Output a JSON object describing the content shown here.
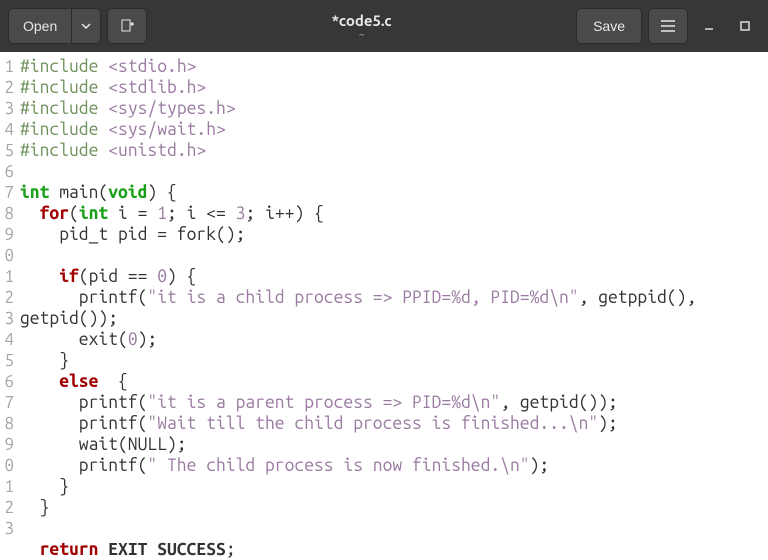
{
  "header": {
    "open_label": "Open",
    "save_label": "Save",
    "title": "*code5.c",
    "subtitle": "~"
  },
  "gutter": [
    "1",
    "2",
    "3",
    "4",
    "5",
    "6",
    "7",
    "8",
    "9",
    "0",
    "1",
    "2",
    "3",
    "4",
    "5",
    "6",
    "7",
    "8",
    "9",
    "0",
    "1",
    "2",
    "3"
  ],
  "code": {
    "lines": [
      {
        "t": "include",
        "header": "<stdio.h>"
      },
      {
        "t": "include",
        "header": "<stdlib.h>"
      },
      {
        "t": "include",
        "header": "<sys/types.h>"
      },
      {
        "t": "include",
        "header": "<sys/wait.h>"
      },
      {
        "t": "include",
        "header": "<unistd.h>"
      },
      {
        "t": "blank"
      },
      {
        "t": "main_sig"
      },
      {
        "t": "for_sig"
      },
      {
        "t": "pid_decl"
      },
      {
        "t": "blank"
      },
      {
        "t": "if_sig"
      },
      {
        "t": "printf_child",
        "str": "\"it is a child process => PPID=%d, PID=%d\\n\""
      },
      {
        "t": "exit0"
      },
      {
        "t": "close_brace",
        "indent": "    "
      },
      {
        "t": "else_sig"
      },
      {
        "t": "printf_parent",
        "str": "\"it is a parent process => PID=%d\\n\""
      },
      {
        "t": "printf_wait",
        "str": "\"Wait till the child process is finished...\\n\""
      },
      {
        "t": "wait_null"
      },
      {
        "t": "printf_done",
        "str": "\" The child process is now finished.\\n\""
      },
      {
        "t": "close_brace",
        "indent": "    "
      },
      {
        "t": "close_brace",
        "indent": "  "
      },
      {
        "t": "blank"
      },
      {
        "t": "return_exit"
      }
    ],
    "tokens": {
      "include": "#include",
      "int": "int",
      "void": "void",
      "main": "main",
      "for": "for",
      "if": "if",
      "else": "else",
      "return": "return",
      "pid_t": "pid_t",
      "pid": "pid",
      "fork": "fork",
      "printf": "printf",
      "getppid": "getppid",
      "getpid": "getpid",
      "exit": "exit",
      "wait": "wait",
      "NULL": "NULL",
      "EXIT_SUCCESS": "EXIT SUCCESS",
      "i": "i",
      "one": "1",
      "three": "3",
      "zero": "0",
      "getpid_wrap": "getpid());"
    }
  }
}
